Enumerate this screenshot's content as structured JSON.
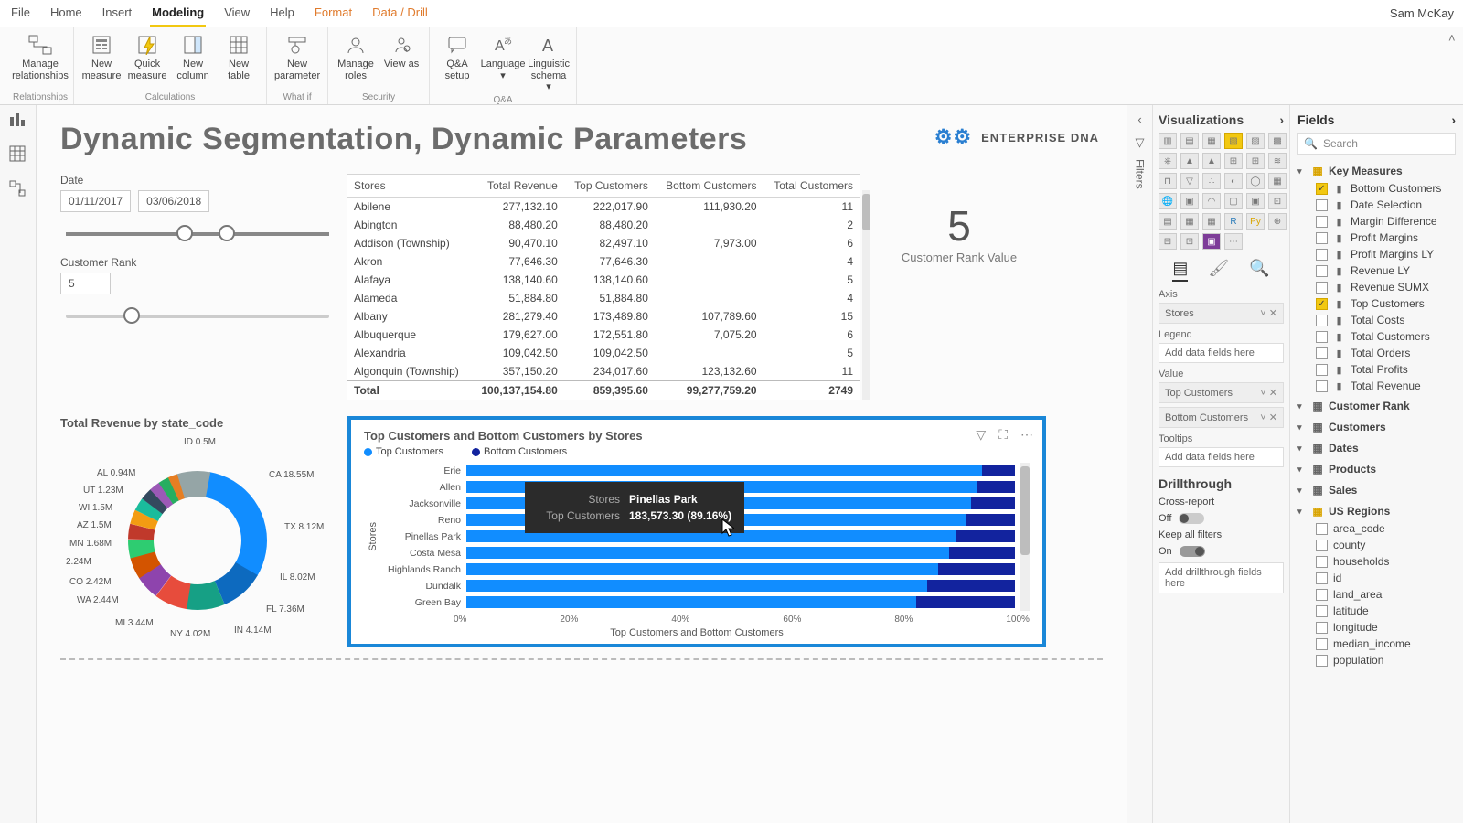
{
  "username": "Sam McKay",
  "menuTabs": [
    "File",
    "Home",
    "Insert",
    "Modeling",
    "View",
    "Help",
    "Format",
    "Data / Drill"
  ],
  "activeMenuTab": "Modeling",
  "ribbon": {
    "groups": [
      {
        "label": "Relationships",
        "buttons": [
          {
            "label": "Manage relationships"
          }
        ]
      },
      {
        "label": "Calculations",
        "buttons": [
          {
            "label": "New measure"
          },
          {
            "label": "Quick measure"
          },
          {
            "label": "New column"
          },
          {
            "label": "New table"
          }
        ]
      },
      {
        "label": "What if",
        "buttons": [
          {
            "label": "New parameter"
          }
        ]
      },
      {
        "label": "Security",
        "buttons": [
          {
            "label": "Manage roles"
          },
          {
            "label": "View as"
          }
        ]
      },
      {
        "label": "Q&A",
        "buttons": [
          {
            "label": "Q&A setup"
          },
          {
            "label": "Language"
          },
          {
            "label": "Linguistic schema"
          }
        ]
      }
    ]
  },
  "report": {
    "title": "Dynamic Segmentation, Dynamic Parameters",
    "brand": "ENTERPRISE DNA"
  },
  "dateSlicer": {
    "label": "Date",
    "from": "01/11/2017",
    "to": "03/06/2018",
    "thumbA": 42,
    "thumbB": 58
  },
  "rankSlicer": {
    "label": "Customer Rank",
    "value": "5",
    "thumbPct": 22
  },
  "card": {
    "value": "5",
    "caption": "Customer Rank Value"
  },
  "table": {
    "headers": [
      "Stores",
      "Total Revenue",
      "Top Customers",
      "Bottom Customers",
      "Total Customers"
    ],
    "rows": [
      [
        "Abilene",
        "277,132.10",
        "222,017.90",
        "111,930.20",
        "11"
      ],
      [
        "Abington",
        "88,480.20",
        "88,480.20",
        "",
        "2"
      ],
      [
        "Addison (Township)",
        "90,470.10",
        "82,497.10",
        "7,973.00",
        "6"
      ],
      [
        "Akron",
        "77,646.30",
        "77,646.30",
        "",
        "4"
      ],
      [
        "Alafaya",
        "138,140.60",
        "138,140.60",
        "",
        "5"
      ],
      [
        "Alameda",
        "51,884.80",
        "51,884.80",
        "",
        "4"
      ],
      [
        "Albany",
        "281,279.40",
        "173,489.80",
        "107,789.60",
        "15"
      ],
      [
        "Albuquerque",
        "179,627.00",
        "172,551.80",
        "7,075.20",
        "6"
      ],
      [
        "Alexandria",
        "109,042.50",
        "109,042.50",
        "",
        "5"
      ],
      [
        "Algonquin (Township)",
        "357,150.20",
        "234,017.60",
        "123,132.60",
        "11"
      ]
    ],
    "total": [
      "Total",
      "100,137,154.80",
      "859,395.60",
      "99,277,759.20",
      "2749"
    ]
  },
  "donut": {
    "title": "Total Revenue by state_code",
    "labels": {
      "top": "ID 0.5M",
      "ca": "CA 18.55M",
      "tx": "TX 8.12M",
      "il": "IL 8.02M",
      "fl": "FL 7.36M",
      "in": "IN 4.14M",
      "ny": "NY 4.02M",
      "mi": "MI 3.44M",
      "wa": "WA 2.44M",
      "co": "CO 2.42M",
      "mo": "2.24M",
      "mn": "MN 1.68M",
      "az": "AZ 1.5M",
      "wi": "WI 1.5M",
      "ut": "UT 1.23M",
      "al": "AL 0.94M"
    }
  },
  "barChart": {
    "title": "Top Customers and Bottom Customers by Stores",
    "series": [
      "Top Customers",
      "Bottom Customers"
    ],
    "colors": [
      "#118dff",
      "#12239e"
    ],
    "axisLabel": "Stores",
    "xLabel": "Top Customers and Bottom Customers",
    "ticks": [
      "0%",
      "20%",
      "40%",
      "60%",
      "80%",
      "100%"
    ],
    "tooltip": {
      "storesLabel": "Stores",
      "store": "Pinellas Park",
      "metricLabel": "Top Customers",
      "metricVal": "183,573.30 (89.16%)"
    }
  },
  "chart_data": {
    "type": "bar",
    "orientation": "horizontal",
    "stacking": "percent",
    "categories": [
      "Erie",
      "Allen",
      "Jacksonville",
      "Reno",
      "Pinellas Park",
      "Costa Mesa",
      "Highlands Ranch",
      "Dundalk",
      "Green Bay"
    ],
    "series": [
      {
        "name": "Top Customers",
        "values": [
          94,
          93,
          92,
          91,
          89.16,
          88,
          86,
          84,
          82
        ]
      },
      {
        "name": "Bottom Customers",
        "values": [
          6,
          7,
          8,
          9,
          10.84,
          12,
          14,
          16,
          18
        ]
      }
    ],
    "title": "Top Customers and Bottom Customers by Stores",
    "xlabel": "Top Customers and Bottom Customers",
    "ylabel": "Stores",
    "xlim": [
      0,
      100
    ],
    "xticks": [
      0,
      20,
      40,
      60,
      80,
      100
    ]
  },
  "vizPane": {
    "title": "Visualizations",
    "axisLabel": "Axis",
    "axisVal": "Stores",
    "legendLabel": "Legend",
    "legendPH": "Add data fields here",
    "valueLabel": "Value",
    "valueA": "Top Customers",
    "valueB": "Bottom Customers",
    "tooltipsLabel": "Tooltips",
    "tooltipsPH": "Add data fields here",
    "drillLabel": "Drillthrough",
    "crossLabel": "Cross-report",
    "crossVal": "Off",
    "keepLabel": "Keep all filters",
    "keepVal": "On",
    "drillPH": "Add drillthrough fields here"
  },
  "fieldsPane": {
    "title": "Fields",
    "searchPH": "Search",
    "keyMeasures": {
      "label": "Key Measures",
      "items": [
        {
          "label": "Bottom Customers",
          "checked": true
        },
        {
          "label": "Date Selection",
          "checked": false
        },
        {
          "label": "Margin Difference",
          "checked": false
        },
        {
          "label": "Profit Margins",
          "checked": false
        },
        {
          "label": "Profit Margins LY",
          "checked": false
        },
        {
          "label": "Revenue LY",
          "checked": false
        },
        {
          "label": "Revenue SUMX",
          "checked": false
        },
        {
          "label": "Top Customers",
          "checked": true
        },
        {
          "label": "Total Costs",
          "checked": false
        },
        {
          "label": "Total Customers",
          "checked": false
        },
        {
          "label": "Total Orders",
          "checked": false
        },
        {
          "label": "Total Profits",
          "checked": false
        },
        {
          "label": "Total Revenue",
          "checked": false
        }
      ]
    },
    "tables": [
      {
        "label": "Customer Rank"
      },
      {
        "label": "Customers"
      },
      {
        "label": "Dates"
      },
      {
        "label": "Products"
      },
      {
        "label": "Sales"
      }
    ],
    "usRegions": {
      "label": "US Regions",
      "items": [
        {
          "label": "area_code"
        },
        {
          "label": "county"
        },
        {
          "label": "households"
        },
        {
          "label": "id"
        },
        {
          "label": "land_area"
        },
        {
          "label": "latitude"
        },
        {
          "label": "longitude"
        },
        {
          "label": "median_income"
        },
        {
          "label": "population"
        }
      ]
    }
  },
  "filtersLabel": "Filters"
}
